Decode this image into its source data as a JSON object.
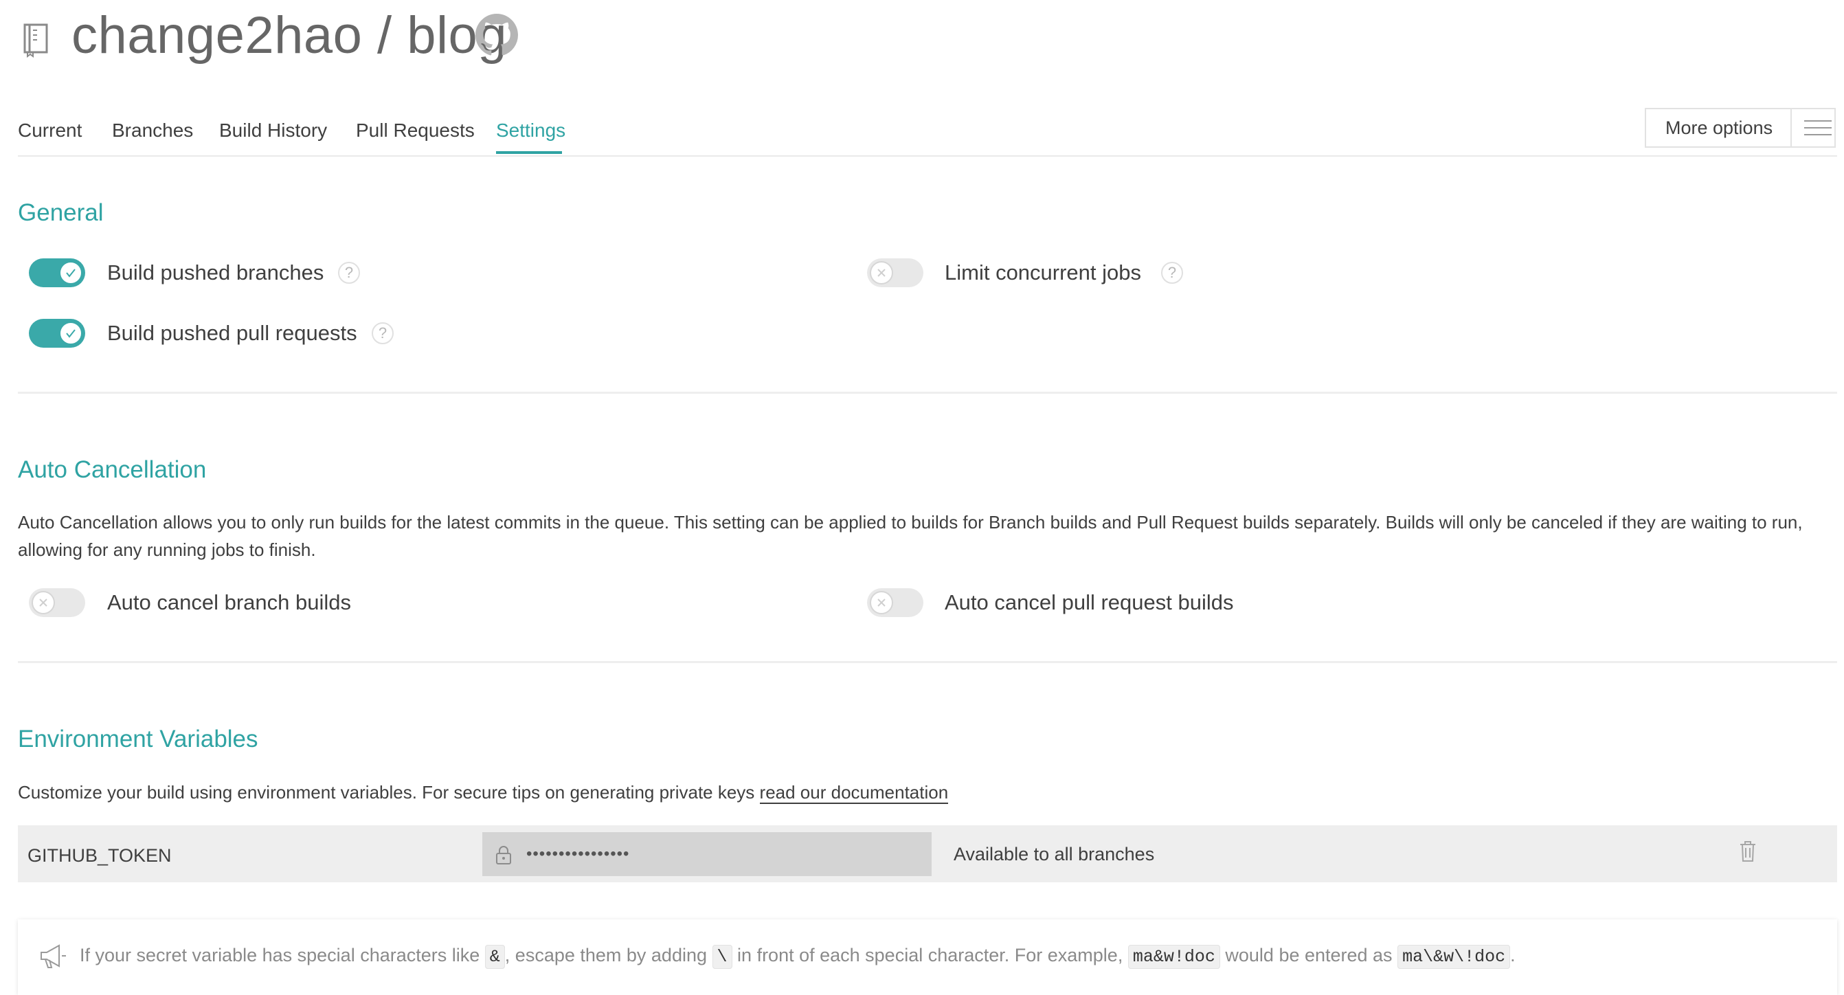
{
  "header": {
    "repo_owner": "change2hao",
    "separator": "/",
    "repo_name": "blog",
    "repo_icon": "repo-book-icon",
    "github_icon": "github-octocat-icon"
  },
  "tabs": [
    {
      "label": "Current",
      "active": false
    },
    {
      "label": "Branches",
      "active": false
    },
    {
      "label": "Build History",
      "active": false
    },
    {
      "label": "Pull Requests",
      "active": false
    },
    {
      "label": "Settings",
      "active": true
    }
  ],
  "more_options": {
    "label": "More options",
    "icon": "hamburger-menu-icon"
  },
  "colors": {
    "accent": "#2fa3a3",
    "toggle_on": "#3aa9a9",
    "toggle_off": "#e8e8e8",
    "text": "#3f3f3f"
  },
  "general": {
    "title": "General",
    "settings": [
      {
        "label": "Build pushed branches",
        "enabled": true,
        "help": "?"
      },
      {
        "label": "Limit concurrent jobs",
        "enabled": false,
        "help": "?"
      },
      {
        "label": "Build pushed pull requests",
        "enabled": true,
        "help": "?"
      }
    ]
  },
  "auto_cancellation": {
    "title": "Auto Cancellation",
    "description_line1": "Auto Cancellation allows you to only run builds for the latest commits in the queue. This setting can be applied to builds for Branch builds and Pull Request builds separately. Builds will only be canceled if they are waiting to run,",
    "description_line2": "allowing for any running jobs to finish.",
    "settings": [
      {
        "label": "Auto cancel branch builds",
        "enabled": false
      },
      {
        "label": "Auto cancel pull request builds",
        "enabled": false
      }
    ]
  },
  "environment_variables": {
    "title": "Environment Variables",
    "description": "Customize your build using environment variables. For secure tips on generating private keys",
    "link_text": "read our documentation",
    "variables": [
      {
        "name": "GITHUB_TOKEN",
        "value": "••••••••••••••••",
        "branches": "Available to all branches"
      }
    ],
    "tip": {
      "part1": "If your secret variable has special characters like",
      "code1": "&",
      "part2": ", escape them by adding",
      "code2": "\\",
      "part3": "in front of each special character. For example,",
      "code3": "ma&w!doc",
      "part4": "would be entered as",
      "code4": "ma\\&w\\!doc",
      "part5": "."
    }
  }
}
